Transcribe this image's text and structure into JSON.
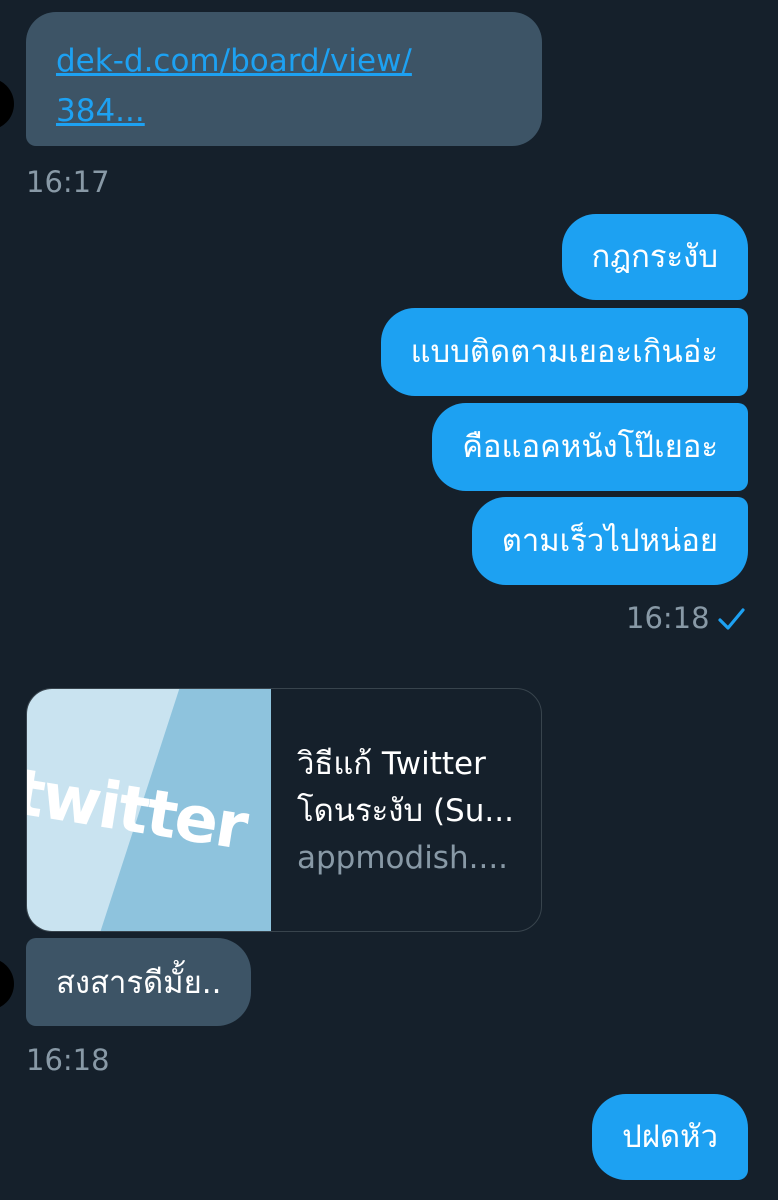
{
  "messages": {
    "in_link": {
      "line1": "dek-d.com/board/view/",
      "line2": "384..."
    },
    "in_link_time": "16:17",
    "out_group1": [
      "กฎกระงับ",
      "แบบติดตามเยอะเกินอ่ะ",
      "คือแอคหนังโป๊เยอะ",
      "ตามเร็วไปหน่อย"
    ],
    "out_group1_time": "16:18",
    "card": {
      "title": "วิธีแก้ Twitter",
      "subtitle": "โดนระงับ (Su...",
      "domain": "appmodish....",
      "thumb_text": "twitter"
    },
    "in_text": "สงสารดีมั้ย..",
    "in_text_time": "16:18",
    "out_last": "ปฝดหัว"
  },
  "colors": {
    "background": "#15202b",
    "incoming_bubble": "#3d5466",
    "outgoing_bubble": "#1da1f2",
    "timestamp": "#8899a6",
    "link": "#1da1f2"
  },
  "icons": {
    "read_receipt": "checkmark-icon"
  }
}
